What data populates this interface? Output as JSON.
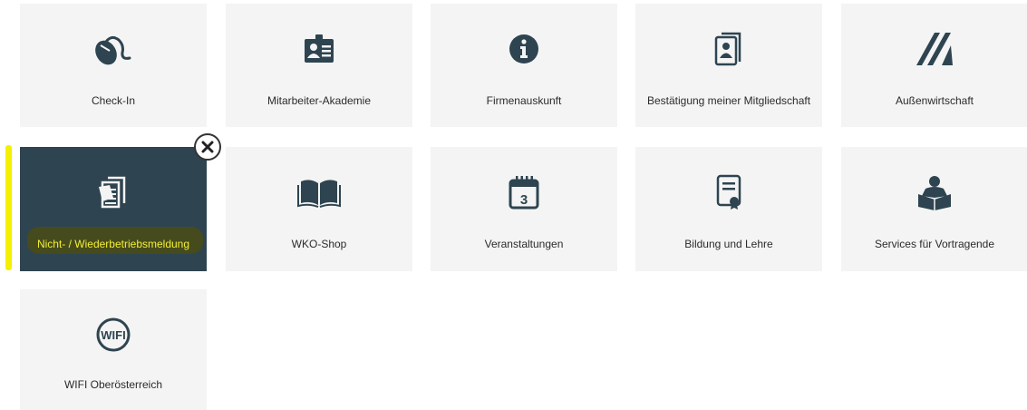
{
  "tiles": [
    {
      "label": "Check-In",
      "icon": "mouse-icon"
    },
    {
      "label": "Mitarbeiter-Akademie",
      "icon": "id-card-icon"
    },
    {
      "label": "Firmenauskunft",
      "icon": "info-icon"
    },
    {
      "label": "Bestätigung meiner Mitgliedschaft",
      "icon": "document-person-icon"
    },
    {
      "label": "Außenwirtschaft",
      "icon": "slash-logo-icon"
    },
    {
      "label": "Nicht- / Wiederbetriebsmeldung",
      "icon": "documents-icon"
    },
    {
      "label": "WKO-Shop",
      "icon": "book-icon"
    },
    {
      "label": "Veranstaltungen",
      "icon": "calendar-icon"
    },
    {
      "label": "Bildung und Lehre",
      "icon": "certificate-icon"
    },
    {
      "label": "Services für Vortragende",
      "icon": "reader-icon"
    },
    {
      "label": "WIFI Oberösterreich",
      "icon": "wifi-logo-icon"
    }
  ],
  "active_tile": "Nicht- / Wiederbetriebsmeldung",
  "wifi_logo_text": "WIFI",
  "colors": {
    "tile_bg": "#f4f4f4",
    "active_bg": "#2e4450",
    "icon": "#2e4450",
    "active_label": "#f3ef33",
    "highlight_marker": "#f5f000"
  }
}
